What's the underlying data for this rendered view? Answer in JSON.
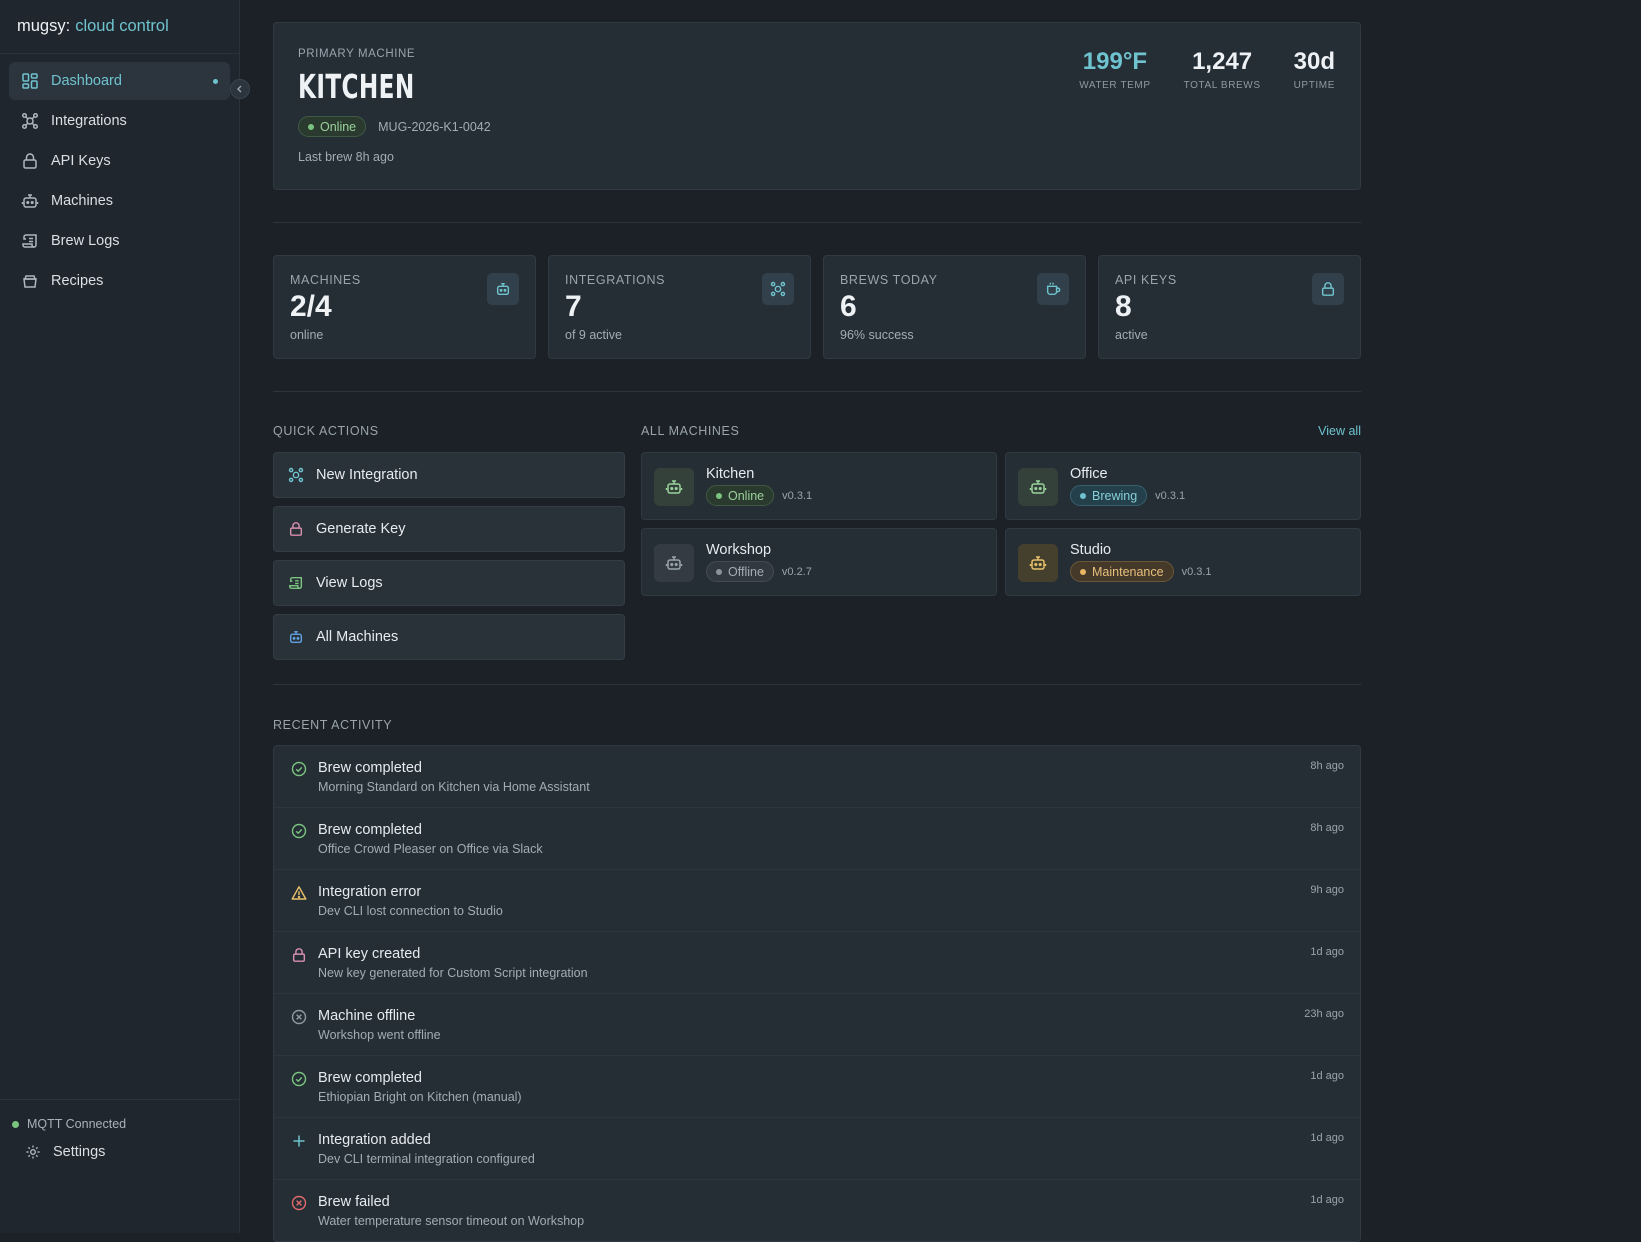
{
  "brand": {
    "name": "mugsy:",
    "accent": "cloud control"
  },
  "sidebar": {
    "items": [
      {
        "label": "Dashboard",
        "icon": "dashboard-icon"
      },
      {
        "label": "Integrations",
        "icon": "integrations-icon"
      },
      {
        "label": "API Keys",
        "icon": "lock-icon"
      },
      {
        "label": "Machines",
        "icon": "robot-icon"
      },
      {
        "label": "Brew Logs",
        "icon": "scroll-icon"
      },
      {
        "label": "Recipes",
        "icon": "recipe-icon"
      }
    ],
    "mqtt_status": "MQTT Connected",
    "settings_label": "Settings"
  },
  "hero": {
    "label": "PRIMARY MACHINE",
    "name": "KITCHEN",
    "status": "Online",
    "serial": "MUG-2026-K1-0042",
    "last_brew": "Last brew 8h ago",
    "metrics": [
      {
        "value": "199°F",
        "label": "WATER TEMP"
      },
      {
        "value": "1,247",
        "label": "TOTAL BREWS"
      },
      {
        "value": "30d",
        "label": "UPTIME"
      }
    ]
  },
  "stats": [
    {
      "label": "MACHINES",
      "value": "2/4",
      "sub": "online",
      "icon": "robot-icon"
    },
    {
      "label": "INTEGRATIONS",
      "value": "7",
      "sub": "of 9 active",
      "icon": "integrations-icon"
    },
    {
      "label": "BREWS TODAY",
      "value": "6",
      "sub": "96% success",
      "icon": "mug-icon"
    },
    {
      "label": "API KEYS",
      "value": "8",
      "sub": "active",
      "icon": "lock-icon"
    }
  ],
  "quick_actions": {
    "title": "QUICK ACTIONS",
    "items": [
      {
        "label": "New Integration",
        "icon": "integrations-icon"
      },
      {
        "label": "Generate Key",
        "icon": "lock-icon"
      },
      {
        "label": "View Logs",
        "icon": "scroll-icon"
      },
      {
        "label": "All Machines",
        "icon": "robot-icon"
      }
    ]
  },
  "machines": {
    "title": "ALL MACHINES",
    "view_all": "View all",
    "items": [
      {
        "name": "Kitchen",
        "status": "Online",
        "version": "v0.3.1"
      },
      {
        "name": "Office",
        "status": "Brewing",
        "version": "v0.3.1"
      },
      {
        "name": "Workshop",
        "status": "Offline",
        "version": "v0.2.7"
      },
      {
        "name": "Studio",
        "status": "Maintenance",
        "version": "v0.3.1"
      }
    ]
  },
  "activity": {
    "title": "RECENT ACTIVITY",
    "items": [
      {
        "title": "Brew completed",
        "desc": "Morning Standard on Kitchen via Home Assistant",
        "time": "8h ago",
        "icon": "check-circle-icon"
      },
      {
        "title": "Brew completed",
        "desc": "Office Crowd Pleaser on Office via Slack",
        "time": "8h ago",
        "icon": "check-circle-icon"
      },
      {
        "title": "Integration error",
        "desc": "Dev CLI lost connection to Studio",
        "time": "9h ago",
        "icon": "warning-icon"
      },
      {
        "title": "API key created",
        "desc": "New key generated for Custom Script integration",
        "time": "1d ago",
        "icon": "lock-icon"
      },
      {
        "title": "Machine offline",
        "desc": "Workshop went offline",
        "time": "23h ago",
        "icon": "x-circle-icon"
      },
      {
        "title": "Brew completed",
        "desc": "Ethiopian Bright on Kitchen (manual)",
        "time": "1d ago",
        "icon": "check-circle-icon"
      },
      {
        "title": "Integration added",
        "desc": "Dev CLI terminal integration configured",
        "time": "1d ago",
        "icon": "plus-icon"
      },
      {
        "title": "Brew failed",
        "desc": "Water temperature sensor timeout on Workshop",
        "time": "1d ago",
        "icon": "x-circle-icon"
      }
    ]
  },
  "colors": {
    "accent": "#6fc3cf",
    "online": "#7bc47f",
    "warning": "#e8c26a",
    "error": "#e06b6b",
    "key": "#d88fb0"
  }
}
